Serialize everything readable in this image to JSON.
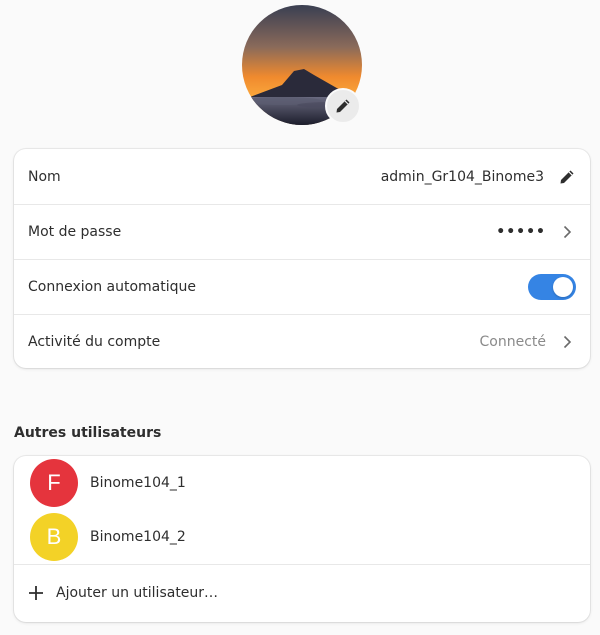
{
  "account": {
    "name_label": "Nom",
    "name_value": "admin_Gr104_Binome3",
    "password_label": "Mot de passe",
    "password_value": "•••••",
    "autologin_label": "Connexion automatique",
    "autologin_enabled": true,
    "activity_label": "Activité du compte",
    "activity_value": "Connecté"
  },
  "other_users": {
    "title": "Autres utilisateurs",
    "users": [
      {
        "initial": "F",
        "name": "Binome104_1",
        "color": "#e5343d"
      },
      {
        "initial": "B",
        "name": "Binome104_2",
        "color": "#f3d227"
      }
    ],
    "add_label": "Ajouter un utilisateur…"
  },
  "colors": {
    "accent": "#3584e4"
  },
  "icons": {
    "avatar_edit": "pencil-icon",
    "name_edit": "pencil-icon",
    "chevron": "chevron-right-icon",
    "add": "plus-icon"
  }
}
